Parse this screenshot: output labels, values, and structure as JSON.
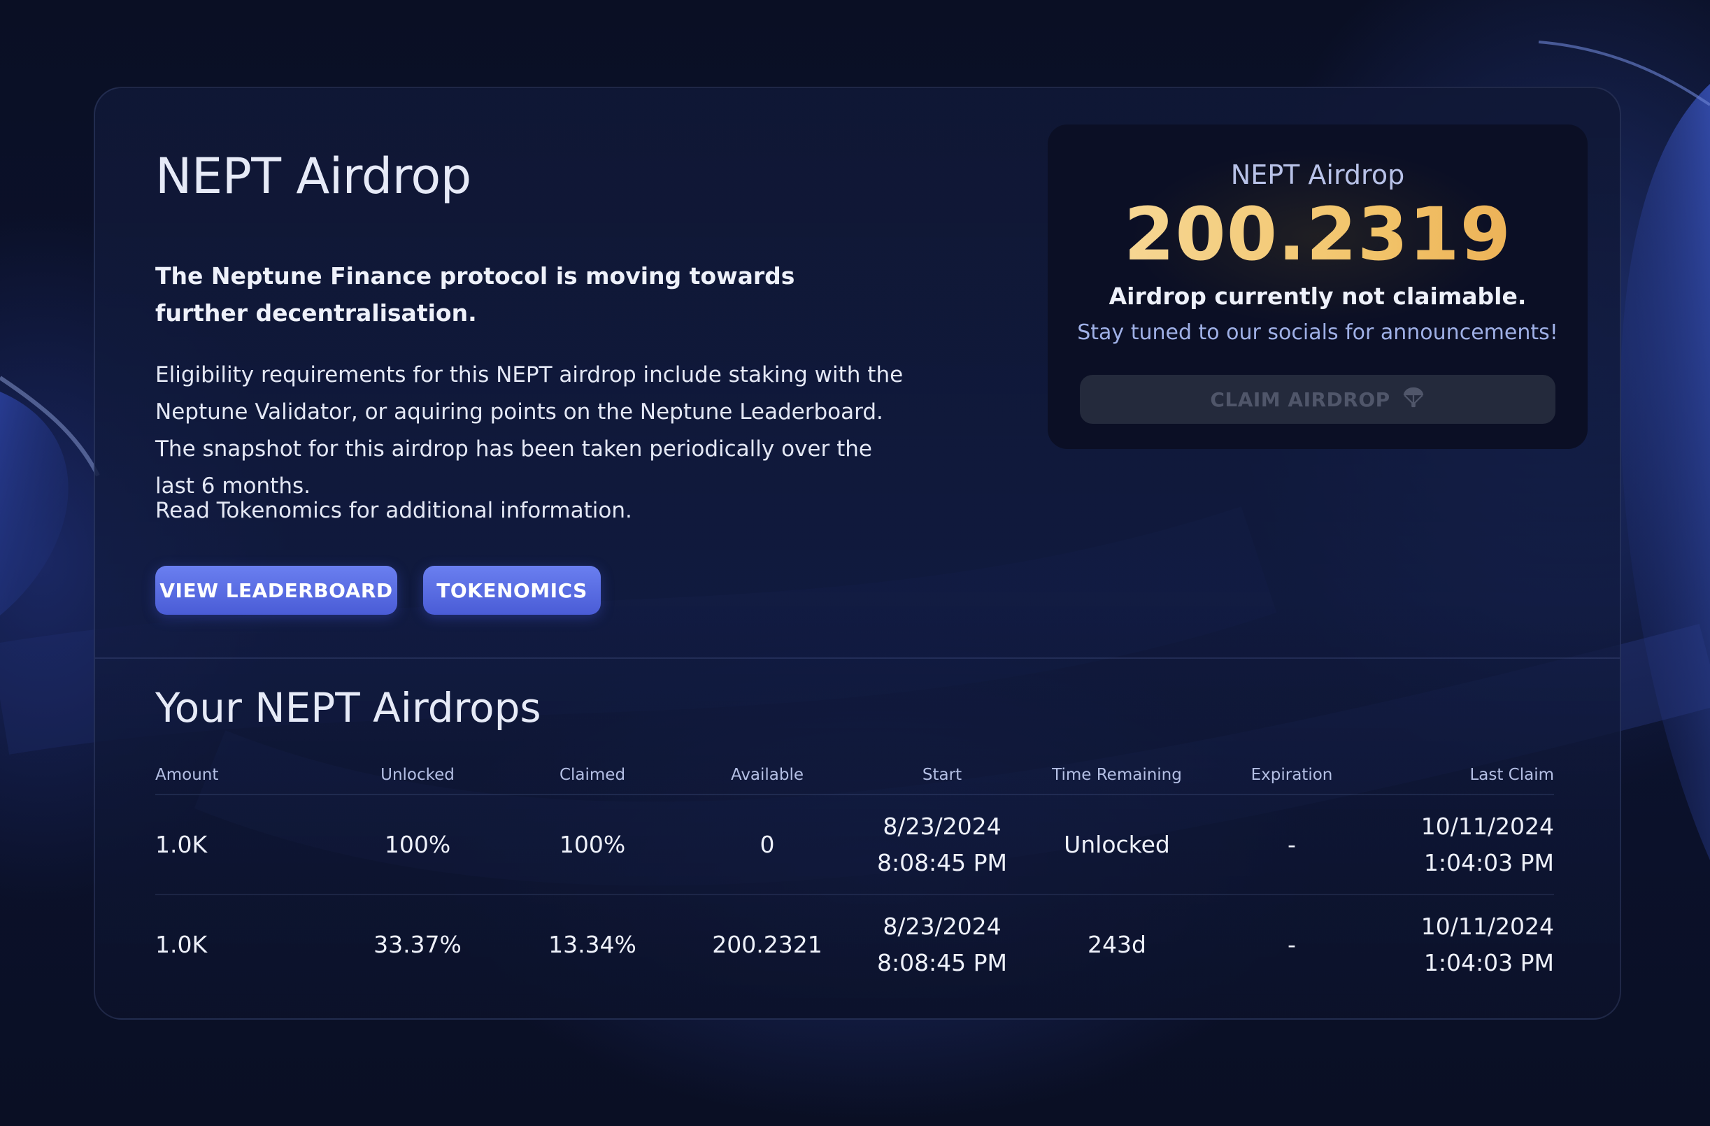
{
  "page": {
    "title": "NEPT Airdrop",
    "lead": "The Neptune Finance protocol is moving towards further decentralisation.",
    "description": "Eligibility requirements for this NEPT airdrop include staking with the Neptune Validator, or aquiring points on the Neptune Leaderboard. The snapshot for this airdrop has been taken periodically over the last 6 months.",
    "read_more": "Read Tokenomics for additional information.",
    "buttons": {
      "leaderboard": "VIEW LEADERBOARD",
      "tokenomics": "TOKENOMICS"
    }
  },
  "airdrop_box": {
    "label": "NEPT Airdrop",
    "amount": "200.2319",
    "status": "Airdrop currently not claimable.",
    "note": "Stay tuned to our socials for announcements!",
    "claim_button": "CLAIM AIRDROP",
    "claim_icon": "parachute-icon",
    "claim_enabled": false
  },
  "airdrops": {
    "title": "Your NEPT Airdrops",
    "columns": [
      "Amount",
      "Unlocked",
      "Claimed",
      "Available",
      "Start",
      "Time Remaining",
      "Expiration",
      "Last Claim"
    ],
    "rows": [
      {
        "amount": "1.0K",
        "unlocked": "100%",
        "claimed": "100%",
        "available": "0",
        "start_date": "8/23/2024",
        "start_time": "8:08:45 PM",
        "time_remaining": "Unlocked",
        "expiration": "-",
        "last_claim_date": "10/11/2024",
        "last_claim_time": "1:04:03 PM"
      },
      {
        "amount": "1.0K",
        "unlocked": "33.37%",
        "claimed": "13.34%",
        "available": "200.2321",
        "start_date": "8/23/2024",
        "start_time": "8:08:45 PM",
        "time_remaining": "243d",
        "expiration": "-",
        "last_claim_date": "10/11/2024",
        "last_claim_time": "1:04:03 PM"
      }
    ]
  },
  "colors": {
    "background": "#0b1128",
    "accent_button": "#5a6ee6",
    "amount_gold": "#f2c46a",
    "muted_text": "#b4bfe4"
  }
}
